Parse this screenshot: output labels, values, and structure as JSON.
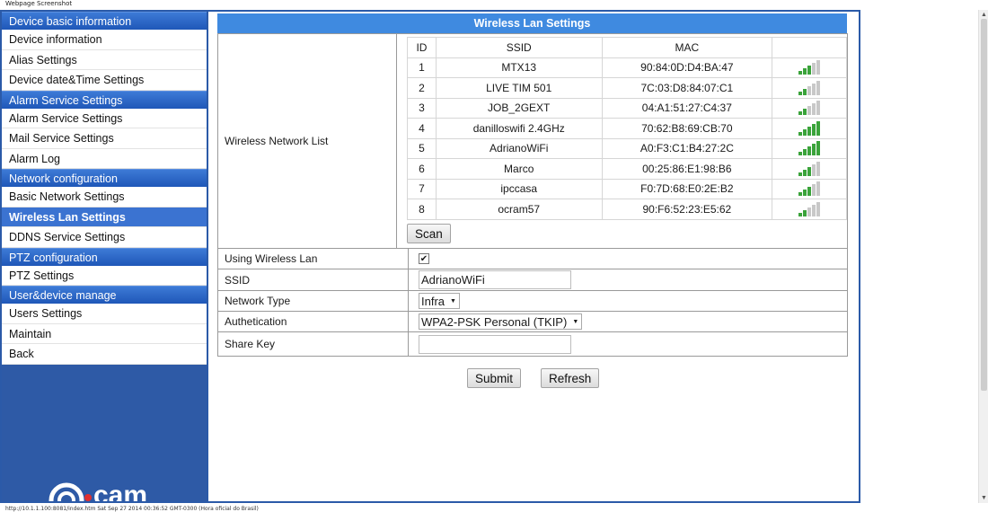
{
  "page_caption": "Webpage Screenshot",
  "footer": "http://10.1.1.100:8081/index.htm Sat Sep 27 2014 00:36:52 GMT-0300 (Hora oficial do Brasil)",
  "sidebar": {
    "sections": [
      {
        "header": "Device basic information",
        "items": [
          "Device information",
          "Alias Settings",
          "Device date&Time Settings"
        ]
      },
      {
        "header": "Alarm Service Settings",
        "items": [
          "Alarm Service Settings",
          "Mail Service Settings",
          "Alarm Log"
        ]
      },
      {
        "header": "Network configuration",
        "items": [
          "Basic Network Settings",
          "Wireless Lan Settings",
          "DDNS Service Settings"
        ]
      },
      {
        "header": "PTZ configuration",
        "items": [
          "PTZ Settings"
        ]
      },
      {
        "header": "User&device manage",
        "items": [
          "Users Settings",
          "Maintain",
          "Back"
        ]
      }
    ],
    "logo_text": "cam"
  },
  "main": {
    "title": "Wireless Lan Settings",
    "wireless_list_label": "Wireless Network List",
    "table": {
      "headers": [
        "ID",
        "SSID",
        "MAC"
      ],
      "rows": [
        {
          "id": "1",
          "ssid": "MTX13",
          "mac": "90:84:0D:D4:BA:47",
          "signal": 3
        },
        {
          "id": "2",
          "ssid": "LIVE TIM 501",
          "mac": "7C:03:D8:84:07:C1",
          "signal": 2
        },
        {
          "id": "3",
          "ssid": "JOB_2GEXT",
          "mac": "04:A1:51:27:C4:37",
          "signal": 2
        },
        {
          "id": "4",
          "ssid": "danilloswifi 2.4GHz",
          "mac": "70:62:B8:69:CB:70",
          "signal": 5
        },
        {
          "id": "5",
          "ssid": "AdrianoWiFi",
          "mac": "A0:F3:C1:B4:27:2C",
          "signal": 5
        },
        {
          "id": "6",
          "ssid": "Marco",
          "mac": "00:25:86:E1:98:B6",
          "signal": 3
        },
        {
          "id": "7",
          "ssid": "ipccasa",
          "mac": "F0:7D:68:E0:2E:B2",
          "signal": 3
        },
        {
          "id": "8",
          "ssid": "ocram57",
          "mac": "90:F6:52:23:E5:62",
          "signal": 2
        }
      ]
    },
    "scan_label": "Scan",
    "using_wireless_label": "Using Wireless Lan",
    "using_wireless_checked": true,
    "ssid_label": "SSID",
    "ssid_value": "AdrianoWiFi",
    "network_type_label": "Network Type",
    "network_type_value": "Infra",
    "auth_label": "Authetication",
    "auth_value": "WPA2-PSK Personal (TKIP)",
    "share_key_label": "Share Key",
    "share_key_value": "",
    "submit_label": "Submit",
    "refresh_label": "Refresh"
  },
  "colors": {
    "frame": "#2b5aa8",
    "title_bar": "#3f8ae0",
    "active_item": "#3b73d1",
    "signal_on": "#3aa33a",
    "signal_off": "#c8c8c8"
  }
}
